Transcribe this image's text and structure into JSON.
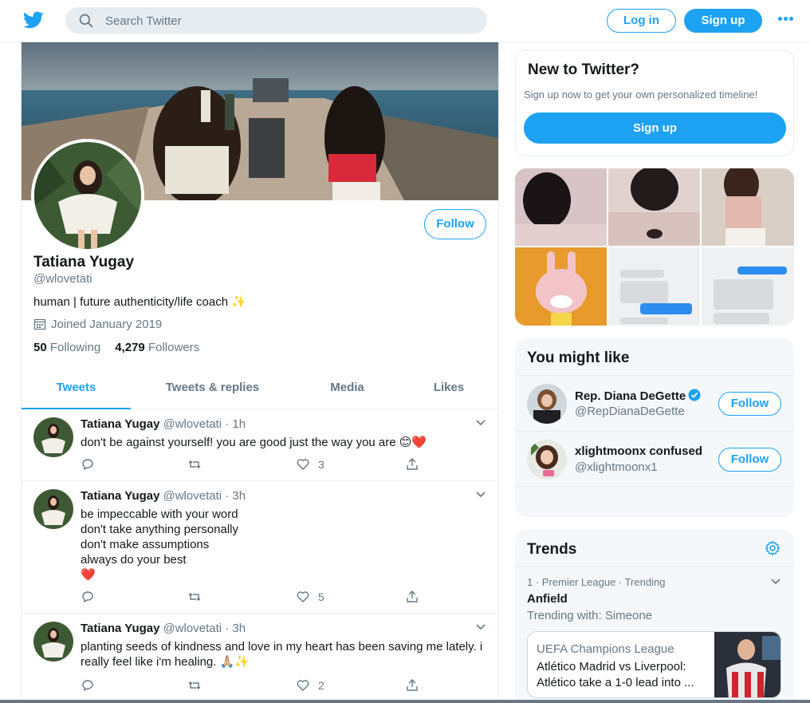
{
  "header": {
    "search_placeholder": "Search Twitter",
    "login_label": "Log in",
    "signup_label": "Sign up",
    "brand_color": "#1da1f2"
  },
  "profile": {
    "name": "Tatiana Yugay",
    "handle": "@wlovetati",
    "bio": "human | future authenticity/life coach ✨",
    "joined": "Joined January 2019",
    "following_count": "50",
    "following_label": "Following",
    "followers_count": "4,279",
    "followers_label": "Followers",
    "follow_label": "Follow"
  },
  "tabs": [
    {
      "label": "Tweets",
      "active": true
    },
    {
      "label": "Tweets & replies",
      "active": false
    },
    {
      "label": "Media",
      "active": false
    },
    {
      "label": "Likes",
      "active": false
    }
  ],
  "tweets": [
    {
      "name": "Tatiana Yugay",
      "handle": "@wlovetati",
      "time": "· 1h",
      "lines": [
        "don't be against yourself! you are good just the way you are 😊❤️"
      ],
      "likes": "3"
    },
    {
      "name": "Tatiana Yugay",
      "handle": "@wlovetati",
      "time": "· 3h",
      "lines": [
        "be impeccable with your word",
        "don't take anything personally",
        "don't make assumptions",
        "always do your best",
        "❤️"
      ],
      "likes": "5"
    },
    {
      "name": "Tatiana Yugay",
      "handle": "@wlovetati",
      "time": "· 3h",
      "lines": [
        "planting seeds of kindness and love in my heart has been saving me lately. i",
        "really feel like i'm healing. 🙏🏼✨"
      ],
      "likes": "2"
    }
  ],
  "new_to_twitter": {
    "title": "New to Twitter?",
    "text": "Sign up now to get your own personalized timeline!",
    "button": "Sign up"
  },
  "you_might_like": {
    "title": "You might like",
    "accounts": [
      {
        "name": "Rep. Diana DeGette",
        "handle": "@RepDianaDeGette",
        "verified": true,
        "button": "Follow"
      },
      {
        "name": "xlightmoonx confused",
        "handle": "@xlightmoonx1",
        "verified": false,
        "button": "Follow"
      }
    ]
  },
  "trends": {
    "title": "Trends",
    "item": {
      "meta": "1 · Premier League · Trending",
      "name": "Anfield",
      "with": "Trending with: Simeone",
      "card_source": "UEFA Champions League",
      "card_headline_1": "Atlético Madrid vs Liverpool:",
      "card_headline_2": "Atlético take a 1-0 lead into ..."
    }
  }
}
